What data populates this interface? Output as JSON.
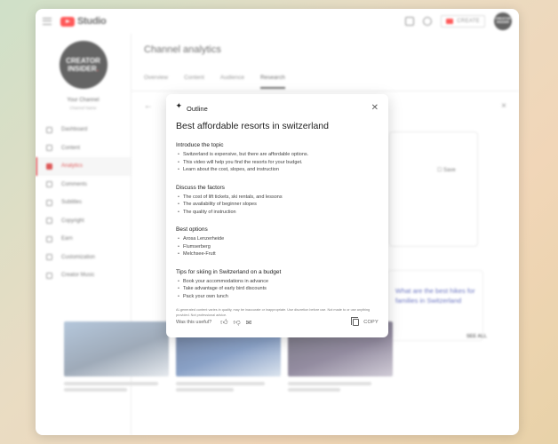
{
  "topbar": {
    "brand": "Studio",
    "create_label": "CREATE",
    "avatar_text": "CREATOR INSIDER"
  },
  "sidebar": {
    "channel_avatar_line1": "CREATOR",
    "channel_avatar_line2": "INSIDER",
    "channel_title": "Your Channel",
    "channel_subtitle": "Channel Name",
    "items": [
      {
        "label": "Dashboard",
        "icon": "dashboard-icon"
      },
      {
        "label": "Content",
        "icon": "content-icon"
      },
      {
        "label": "Analytics",
        "icon": "analytics-icon",
        "active": true
      },
      {
        "label": "Comments",
        "icon": "comments-icon"
      },
      {
        "label": "Subtitles",
        "icon": "subtitles-icon"
      },
      {
        "label": "Copyright",
        "icon": "copyright-icon"
      },
      {
        "label": "Earn",
        "icon": "earn-icon"
      },
      {
        "label": "Customization",
        "icon": "customization-icon"
      },
      {
        "label": "Creator Music",
        "icon": "creator-music-icon"
      }
    ]
  },
  "main": {
    "title": "Channel analytics",
    "tabs": [
      "Overview",
      "Content",
      "Audience",
      "Research"
    ],
    "active_tab": "Research",
    "save_label": "Save",
    "suggestion": "What are the best hikes for families in Switzerland",
    "see_all": "SEE ALL"
  },
  "dialog": {
    "label": "Outline",
    "title": "Best affordable resorts in switzerland",
    "sections": [
      {
        "heading": "Introduce the topic",
        "items": [
          "Switzerland is expensive, but there are affordable options.",
          "This video will help you find the resorts for your budget.",
          "Learn about the cost, slopes, and instruction"
        ]
      },
      {
        "heading": "Discuss the factors",
        "items": [
          "The cost of lift tickets, ski rentals, and lessons",
          "The availability of beginner slopes",
          "The quality of instruction"
        ]
      },
      {
        "heading": "Best options",
        "items": [
          "Arosa Lenzerheide",
          "Flumserberg",
          "Melchsee-Frutt"
        ]
      },
      {
        "heading": "Tips for skiing in Switzerland on a budget",
        "items": [
          "Book your accommodations in advance",
          "Take advantage of early bird discounts",
          "Pack your own lunch"
        ]
      }
    ],
    "disclaimer": "AI-generated content varies in quality, may be inaccurate or inappropriate. Use discretion before use. Not made to or use anything provided. Not professional advice.",
    "feedback_label": "Was this useful?",
    "copy_label": "COPY"
  }
}
